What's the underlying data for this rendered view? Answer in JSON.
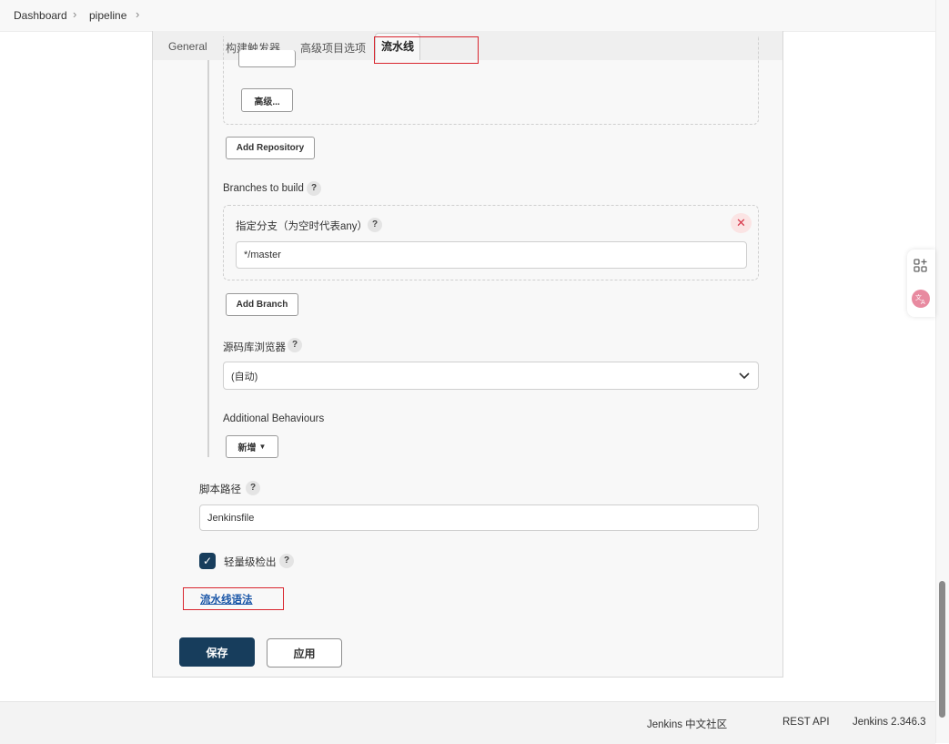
{
  "breadcrumb": {
    "items": [
      "Dashboard",
      "pipeline"
    ]
  },
  "tabs": [
    "General",
    "构建触发器",
    "高级项目选项",
    "流水线"
  ],
  "active_tab": "流水线",
  "scm": {
    "advanced_button": "高级...",
    "add_repository": "Add Repository",
    "branches_label": "Branches to build",
    "branch_specifier_label": "指定分支（为空时代表any）",
    "branch_value": "*/master",
    "add_branch": "Add Branch",
    "browser_label": "源码库浏览器",
    "browser_value": "(自动)",
    "behaviours_label": "Additional Behaviours",
    "add_behaviour": "新增"
  },
  "script_path": {
    "label": "脚本路径",
    "value": "Jenkinsfile"
  },
  "lightweight_checkout": {
    "label": "轻量级检出",
    "checked": true
  },
  "pipeline_syntax_link": "流水线语法",
  "buttons": {
    "save": "保存",
    "apply": "应用"
  },
  "footer": {
    "community": "Jenkins 中文社区",
    "rest_api": "REST API",
    "version": "Jenkins 2.346.3"
  },
  "colors": {
    "primary": "#173d5c",
    "highlight": "#d9252e",
    "link": "#1a56a7"
  },
  "help_glyph": "?",
  "icons": [
    "chevron-right-icon",
    "close-icon",
    "chevron-down-icon",
    "check-icon",
    "apps-add-icon",
    "translate-icon"
  ]
}
